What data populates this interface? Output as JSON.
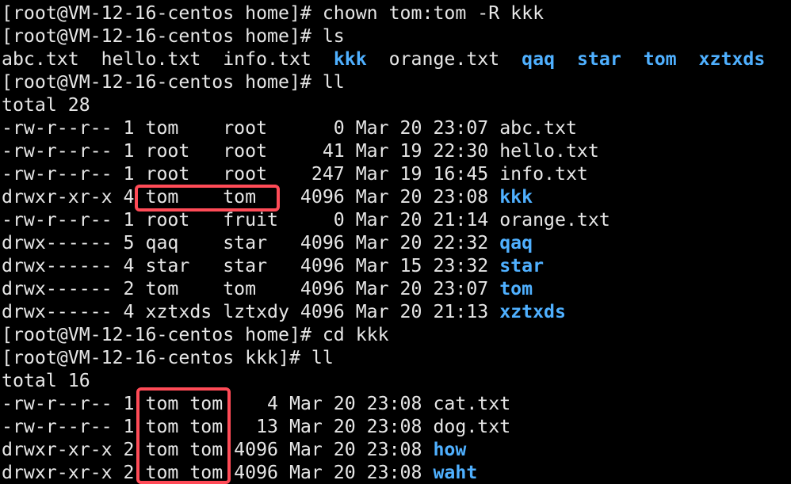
{
  "colors": {
    "background": "#000000",
    "text": "#e6e6e6",
    "directory": "#4fb0ff",
    "highlight": "#ff4b57"
  },
  "lines": [
    [
      {
        "t": "[root@VM-12-16-centos home]# chown tom:tom -R kkk"
      }
    ],
    [
      {
        "t": "[root@VM-12-16-centos home]# ls"
      }
    ],
    [
      {
        "t": "abc.txt  hello.txt  info.txt  "
      },
      {
        "t": "kkk",
        "dir": true
      },
      {
        "t": "  orange.txt  "
      },
      {
        "t": "qaq",
        "dir": true
      },
      {
        "t": "  "
      },
      {
        "t": "star",
        "dir": true
      },
      {
        "t": "  "
      },
      {
        "t": "tom",
        "dir": true
      },
      {
        "t": "  "
      },
      {
        "t": "xztxds",
        "dir": true
      }
    ],
    [
      {
        "t": "[root@VM-12-16-centos home]# ll"
      }
    ],
    [
      {
        "t": "total 28"
      }
    ],
    [
      {
        "t": "-rw-r--r-- 1 tom    root      0 Mar 20 23:07 abc.txt"
      }
    ],
    [
      {
        "t": "-rw-r--r-- 1 root   root     41 Mar 19 22:30 hello.txt"
      }
    ],
    [
      {
        "t": "-rw-r--r-- 1 root   root    247 Mar 19 16:45 info.txt"
      }
    ],
    [
      {
        "t": "drwxr-xr-x 4 tom    tom    4096 Mar 20 23:08 "
      },
      {
        "t": "kkk",
        "dir": true
      }
    ],
    [
      {
        "t": "-rw-r--r-- 1 root   fruit     0 Mar 20 21:14 orange.txt"
      }
    ],
    [
      {
        "t": "drwx------ 5 qaq    star   4096 Mar 20 22:32 "
      },
      {
        "t": "qaq",
        "dir": true
      }
    ],
    [
      {
        "t": "drwx------ 4 star   star   4096 Mar 15 23:32 "
      },
      {
        "t": "star",
        "dir": true
      }
    ],
    [
      {
        "t": "drwx------ 2 tom    tom    4096 Mar 20 23:07 "
      },
      {
        "t": "tom",
        "dir": true
      }
    ],
    [
      {
        "t": "drwx------ 4 xztxds lztxdy 4096 Mar 20 21:13 "
      },
      {
        "t": "xztxds",
        "dir": true
      }
    ],
    [
      {
        "t": "[root@VM-12-16-centos home]# cd kkk"
      }
    ],
    [
      {
        "t": "[root@VM-12-16-centos kkk]# ll"
      }
    ],
    [
      {
        "t": "total 16"
      }
    ],
    [
      {
        "t": "-rw-r--r-- 1 tom tom    4 Mar 20 23:08 cat.txt"
      }
    ],
    [
      {
        "t": "-rw-r--r-- 1 tom tom   13 Mar 20 23:08 dog.txt"
      }
    ],
    [
      {
        "t": "drwxr-xr-x 2 tom tom 4096 Mar 20 23:08 "
      },
      {
        "t": "how",
        "dir": true
      }
    ],
    [
      {
        "t": "drwxr-xr-x 2 tom tom 4096 Mar 20 23:08 "
      },
      {
        "t": "waht",
        "dir": true
      }
    ]
  ]
}
